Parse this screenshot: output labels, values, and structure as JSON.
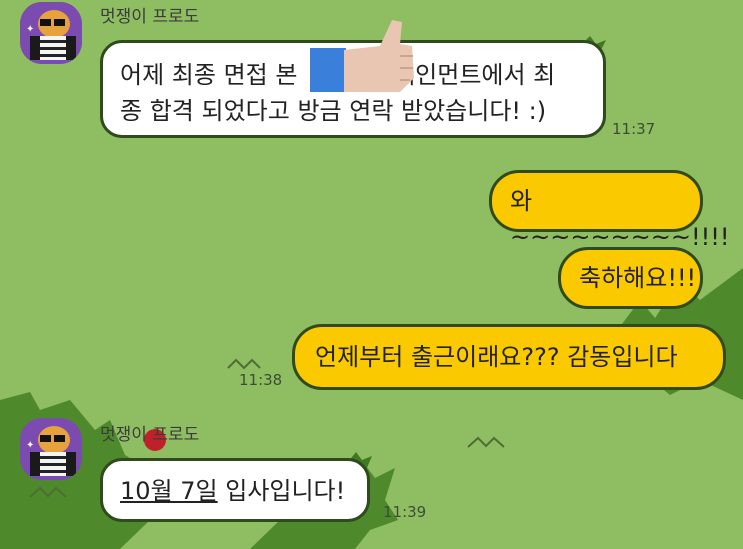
{
  "colors": {
    "background": "#8fbd62",
    "incoming_bubble": "#ffffff",
    "outgoing_bubble": "#fbc900",
    "bubble_border": "#2f4a1c",
    "avatar_bg": "#7b4bb0"
  },
  "chat": {
    "group1": {
      "sender_name": "멋쟁이 프로도",
      "avatar_icon": "frodo-avatar-icon",
      "message_line1": "어제 최종 면접 본 ",
      "message_line1_rest": "테인먼트에서 최",
      "message_line2": "종 합격 되었다고 방금 연락 받았습니다! :)",
      "time": "11:37"
    },
    "outgoing": {
      "msg1": "와~~~~~~~~~!!!!",
      "msg2": "축하해요!!!",
      "msg3": "언제부터 출근이래요??? 감동입니다",
      "time": "11:38"
    },
    "group2": {
      "sender_name": "멋쟁이 프로도",
      "avatar_icon": "frodo-avatar-icon",
      "message_part1": "10월 7일",
      "message_part2": " 입사입니다!",
      "time": "11:39"
    }
  }
}
